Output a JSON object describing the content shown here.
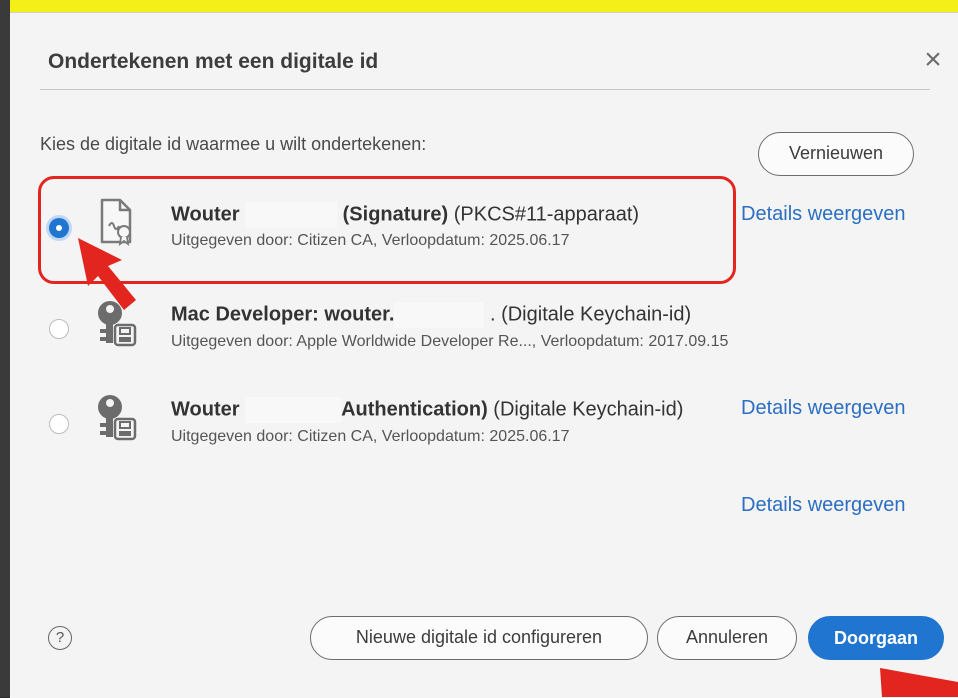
{
  "dialog": {
    "title": "Ondertekenen met een digitale id",
    "close_icon": "close-icon",
    "prompt": "Kies de digitale id waarmee u wilt ondertekenen:",
    "refresh_label": "Vernieuwen"
  },
  "ids": [
    {
      "selected": true,
      "icon": "certificate-file-icon",
      "name_first": "Wouter",
      "name_bold_rest": "(Signature)",
      "type": "(PKCS#11-apparaat)",
      "issuer": "Uitgegeven door: Citizen CA, Verloopdatum: 2025.06.17",
      "details_label": "Details weergeven"
    },
    {
      "selected": false,
      "icon": "keychain-key-icon",
      "name_first": "Mac Developer: wouter.",
      "name_bold_rest": "",
      "type": ". (Digitale Keychain-id)",
      "issuer": "Uitgegeven door: Apple Worldwide Developer Re..., Verloopdatum: 2017.09.15",
      "details_label": ""
    },
    {
      "selected": false,
      "icon": "keychain-key-icon",
      "name_first": "Wouter",
      "name_bold_rest": "Authentication)",
      "type": "(Digitale Keychain-id)",
      "issuer": "Uitgegeven door: Citizen CA, Verloopdatum: 2025.06.17",
      "details_label": "Details weergeven"
    }
  ],
  "extra_details_label": "Details weergeven",
  "footer": {
    "help_icon": "help-icon",
    "help_glyph": "?",
    "new_id_label": "Nieuwe digitale id configureren",
    "cancel_label": "Annuleren",
    "continue_label": "Doorgaan"
  },
  "colors": {
    "accent": "#1f75cf",
    "link": "#2b6ec2",
    "highlight": "#e2251f"
  }
}
